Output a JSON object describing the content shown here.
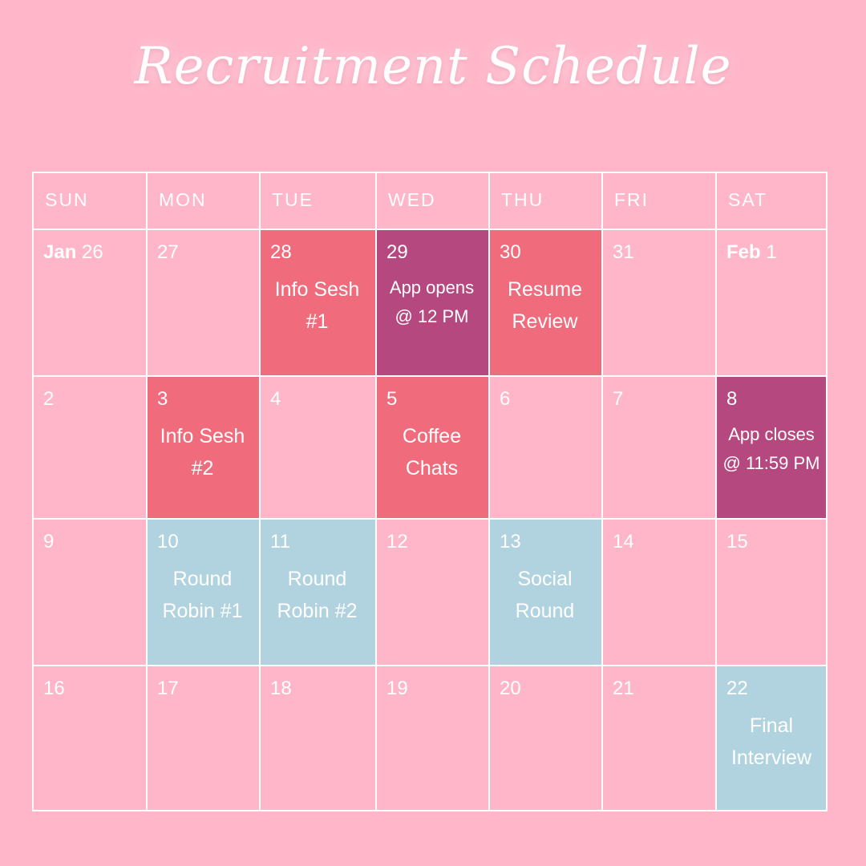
{
  "title": "Recruitment Schedule",
  "colors": {
    "background": "#ffb6c9",
    "coral": "#f06b7b",
    "plum": "#b4487f",
    "blue": "#b0d3df",
    "grid_line": "#ffffff"
  },
  "weekdays": [
    "SUN",
    "MON",
    "TUE",
    "WED",
    "THU",
    "FRI",
    "SAT"
  ],
  "weeks": [
    [
      {
        "month": "Jan",
        "day": "26"
      },
      {
        "day": "27"
      },
      {
        "day": "28",
        "event": [
          "Info Sesh",
          "#1"
        ],
        "color": "#f06b7b"
      },
      {
        "day": "29",
        "event": [
          "App opens",
          "@ 12 PM"
        ],
        "color": "#b4487f",
        "small": true
      },
      {
        "day": "30",
        "event": [
          "Resume",
          "Review"
        ],
        "color": "#f06b7b"
      },
      {
        "day": "31"
      },
      {
        "month": "Feb",
        "day": "1"
      }
    ],
    [
      {
        "day": "2"
      },
      {
        "day": "3",
        "event": [
          "Info Sesh",
          "#2"
        ],
        "color": "#f06b7b"
      },
      {
        "day": "4"
      },
      {
        "day": "5",
        "event": [
          "Coffee",
          "Chats"
        ],
        "color": "#f06b7b"
      },
      {
        "day": "6"
      },
      {
        "day": "7"
      },
      {
        "day": "8",
        "event": [
          "App closes",
          "@ 11:59 PM"
        ],
        "color": "#b4487f",
        "small": true
      }
    ],
    [
      {
        "day": "9"
      },
      {
        "day": "10",
        "event": [
          "Round",
          "Robin #1"
        ],
        "color": "#b0d3df"
      },
      {
        "day": "11",
        "event": [
          "Round",
          "Robin #2"
        ],
        "color": "#b0d3df"
      },
      {
        "day": "12"
      },
      {
        "day": "13",
        "event": [
          "Social",
          "Round"
        ],
        "color": "#b0d3df"
      },
      {
        "day": "14"
      },
      {
        "day": "15"
      }
    ],
    [
      {
        "day": "16"
      },
      {
        "day": "17"
      },
      {
        "day": "18"
      },
      {
        "day": "19"
      },
      {
        "day": "20"
      },
      {
        "day": "21"
      },
      {
        "day": "22",
        "event": [
          "Final",
          "Interview"
        ],
        "color": "#b0d3df"
      }
    ]
  ]
}
